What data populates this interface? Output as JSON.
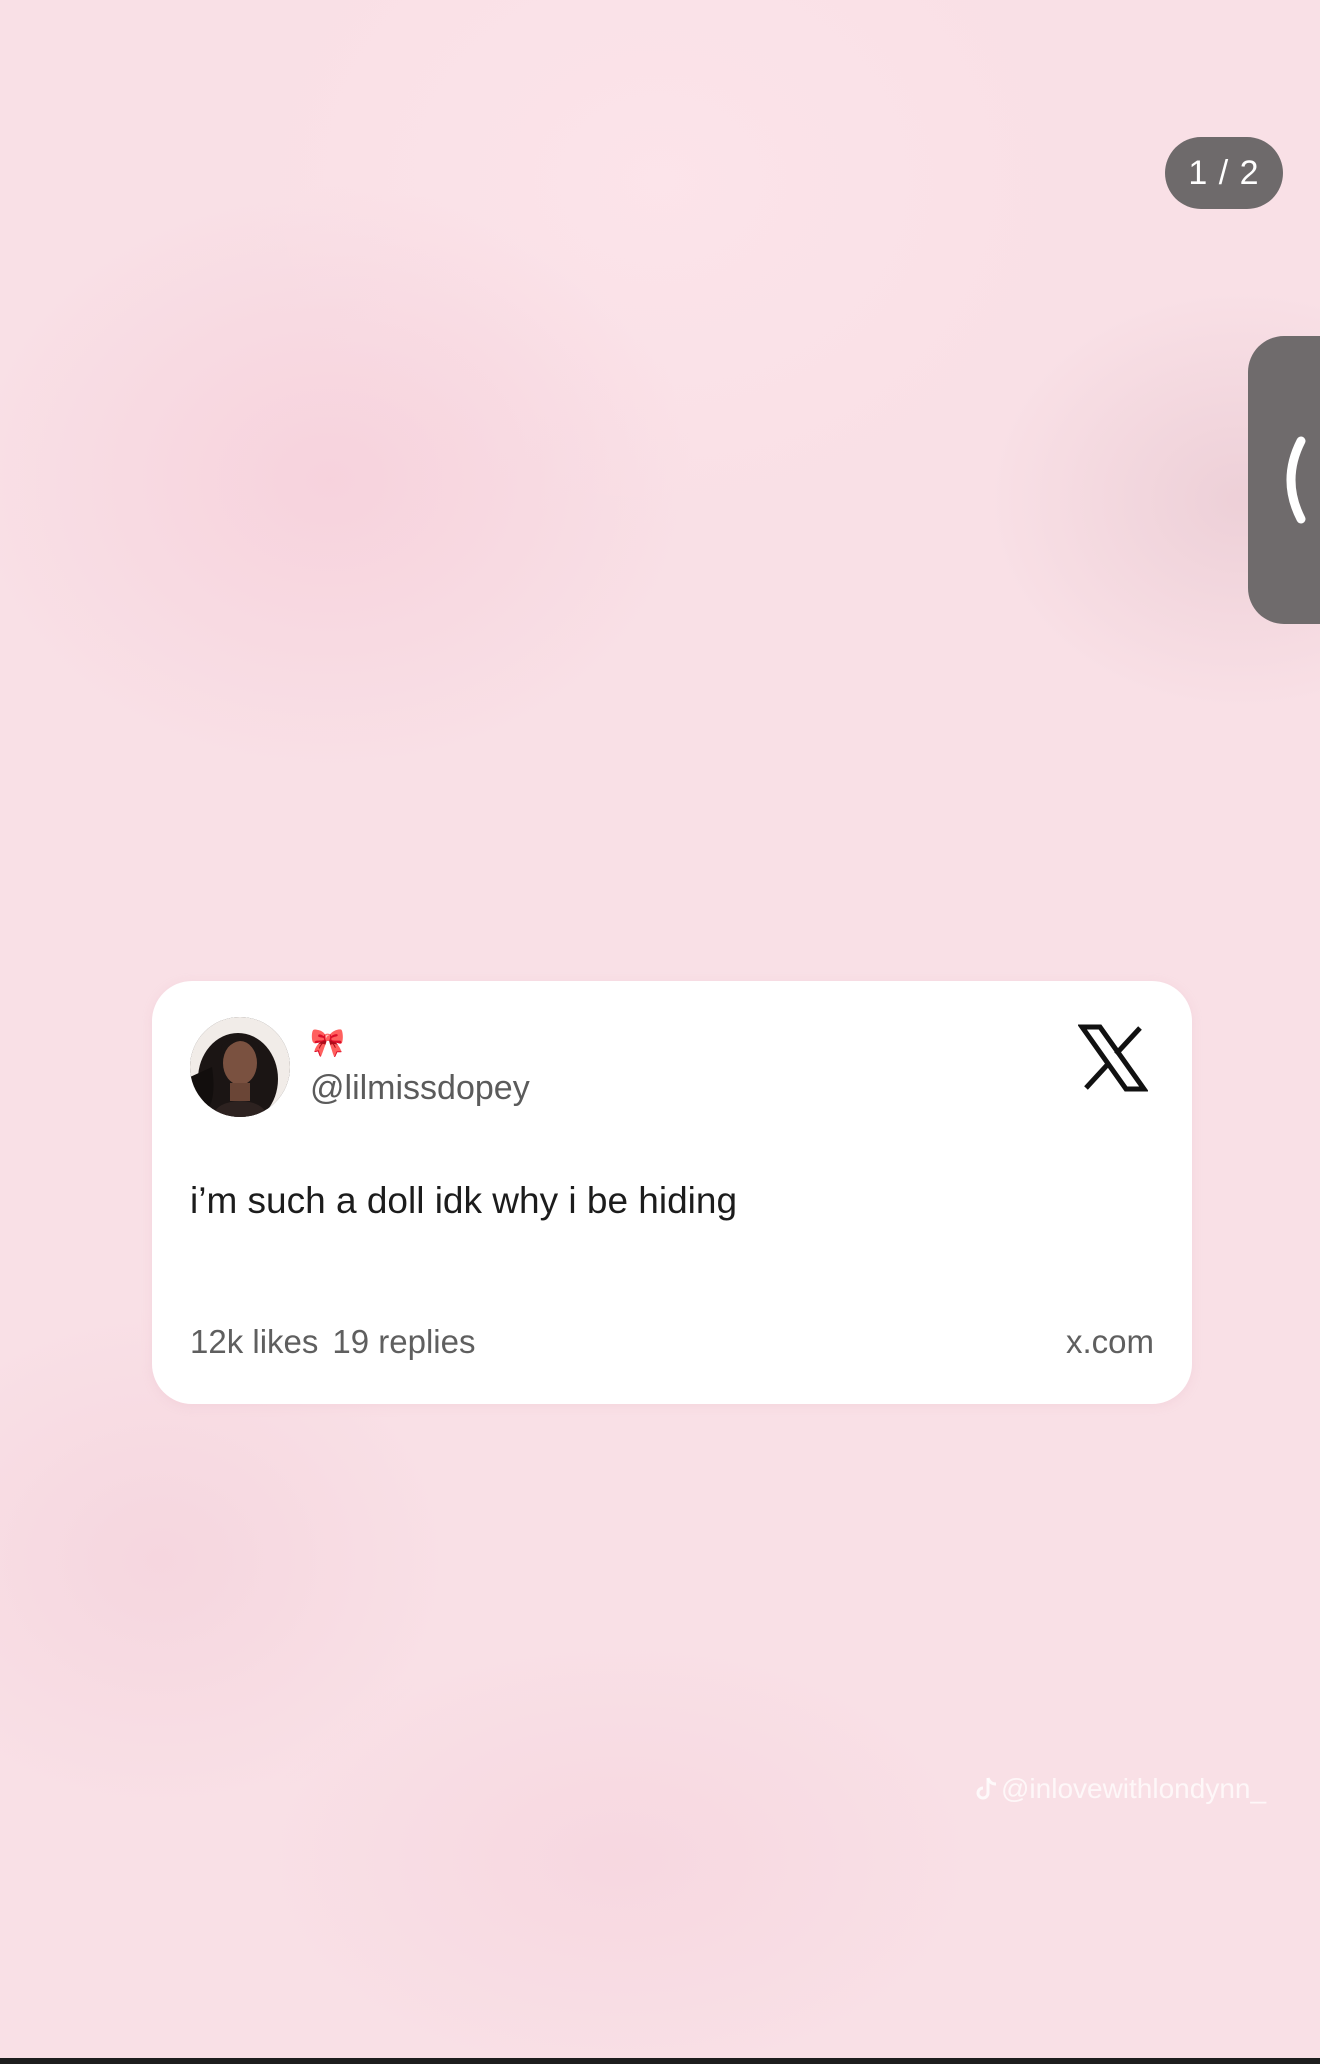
{
  "viewer": {
    "page_counter": "1 / 2",
    "side_tab_icon": "chevron-left-icon"
  },
  "tweet_card": {
    "avatar_icon": "avatar",
    "display_name": "🎀",
    "handle": "@lilmissdopey",
    "brand_icon": "x-logo-icon",
    "text": "i’m such a doll idk why i be hiding",
    "likes": "12k likes",
    "replies": "19 replies",
    "domain": "x.com"
  },
  "watermark": {
    "icon": "tiktok-icon",
    "text": "@inlovewithlondynn_"
  },
  "colors": {
    "background": "#f9e0e6",
    "card": "#ffffff",
    "pill": "#6e6a6b"
  }
}
